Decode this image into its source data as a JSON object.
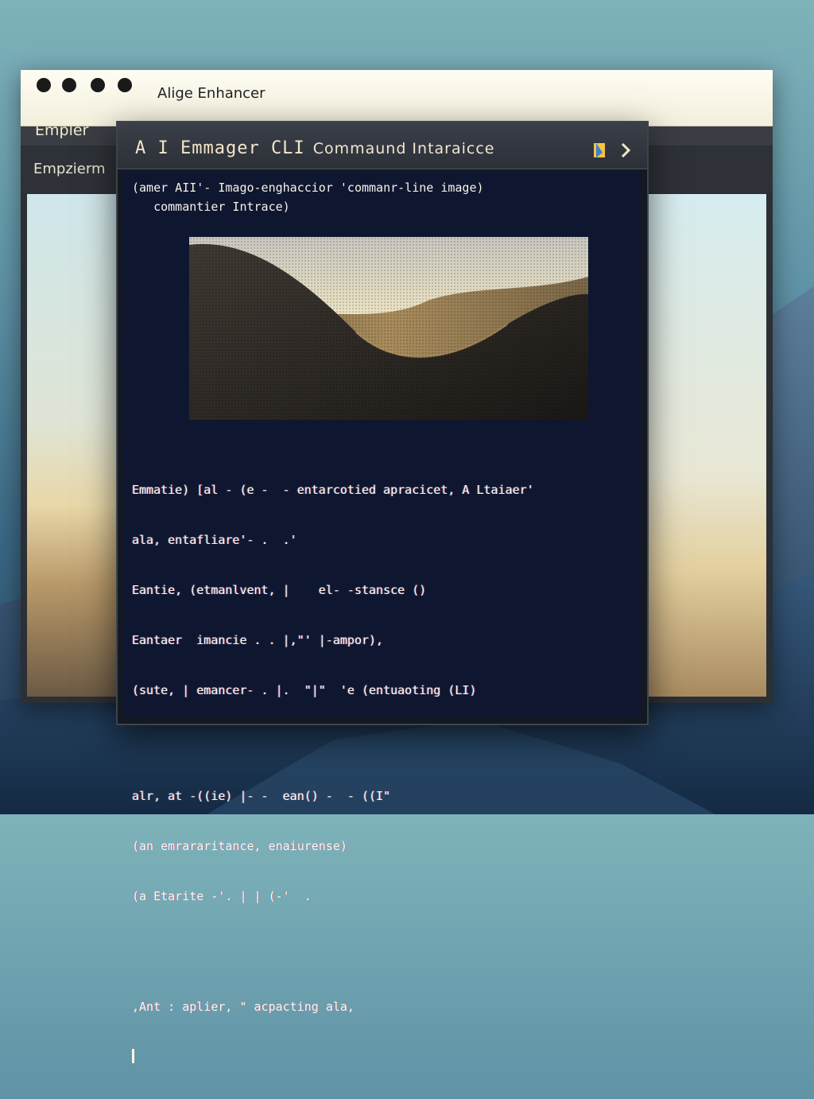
{
  "back_window": {
    "title": "Alige Enhancer",
    "menu_label": "Empler",
    "submenu_label": "Empzierm",
    "traffic_lights": [
      "close",
      "minimize",
      "maximize",
      "extra"
    ]
  },
  "front_window": {
    "title_main": "A I  Emmager CLI",
    "title_sub": "Commaund Intaraicce",
    "header_line_1": "(amer AII'- Imago-enghaccior 'commanr-line image)",
    "header_line_2": "   commantier Intrace)",
    "preview_image": "sand-dune-landscape",
    "lines": [
      "Emmatie) [al - (e -  - entarcotied apracicet, A Ltaiaer'",
      "ala, entafliare'- .  .'",
      "Eantie, (etmanlvent, |    el- -stansce ()",
      "Eantaer  imancie . . |,\"' |-ampor),",
      "(sute, | emancer- . |.  \"|\"  'e (entuaoting (LI)",
      "alr, at -((ie) |- -  ean() -  - ((I\"",
      "(an emrararitance, enaiurense)",
      "(a Etarite -'. | | (-'  .",
      ",Ant : aplier, \" acpacting ala,"
    ]
  },
  "colors": {
    "terminal_bg": "#0f1730",
    "terminal_text": "#fbf7ee",
    "titlebar_text": "#f3e7c9",
    "accent_icon": "#f5c542"
  }
}
